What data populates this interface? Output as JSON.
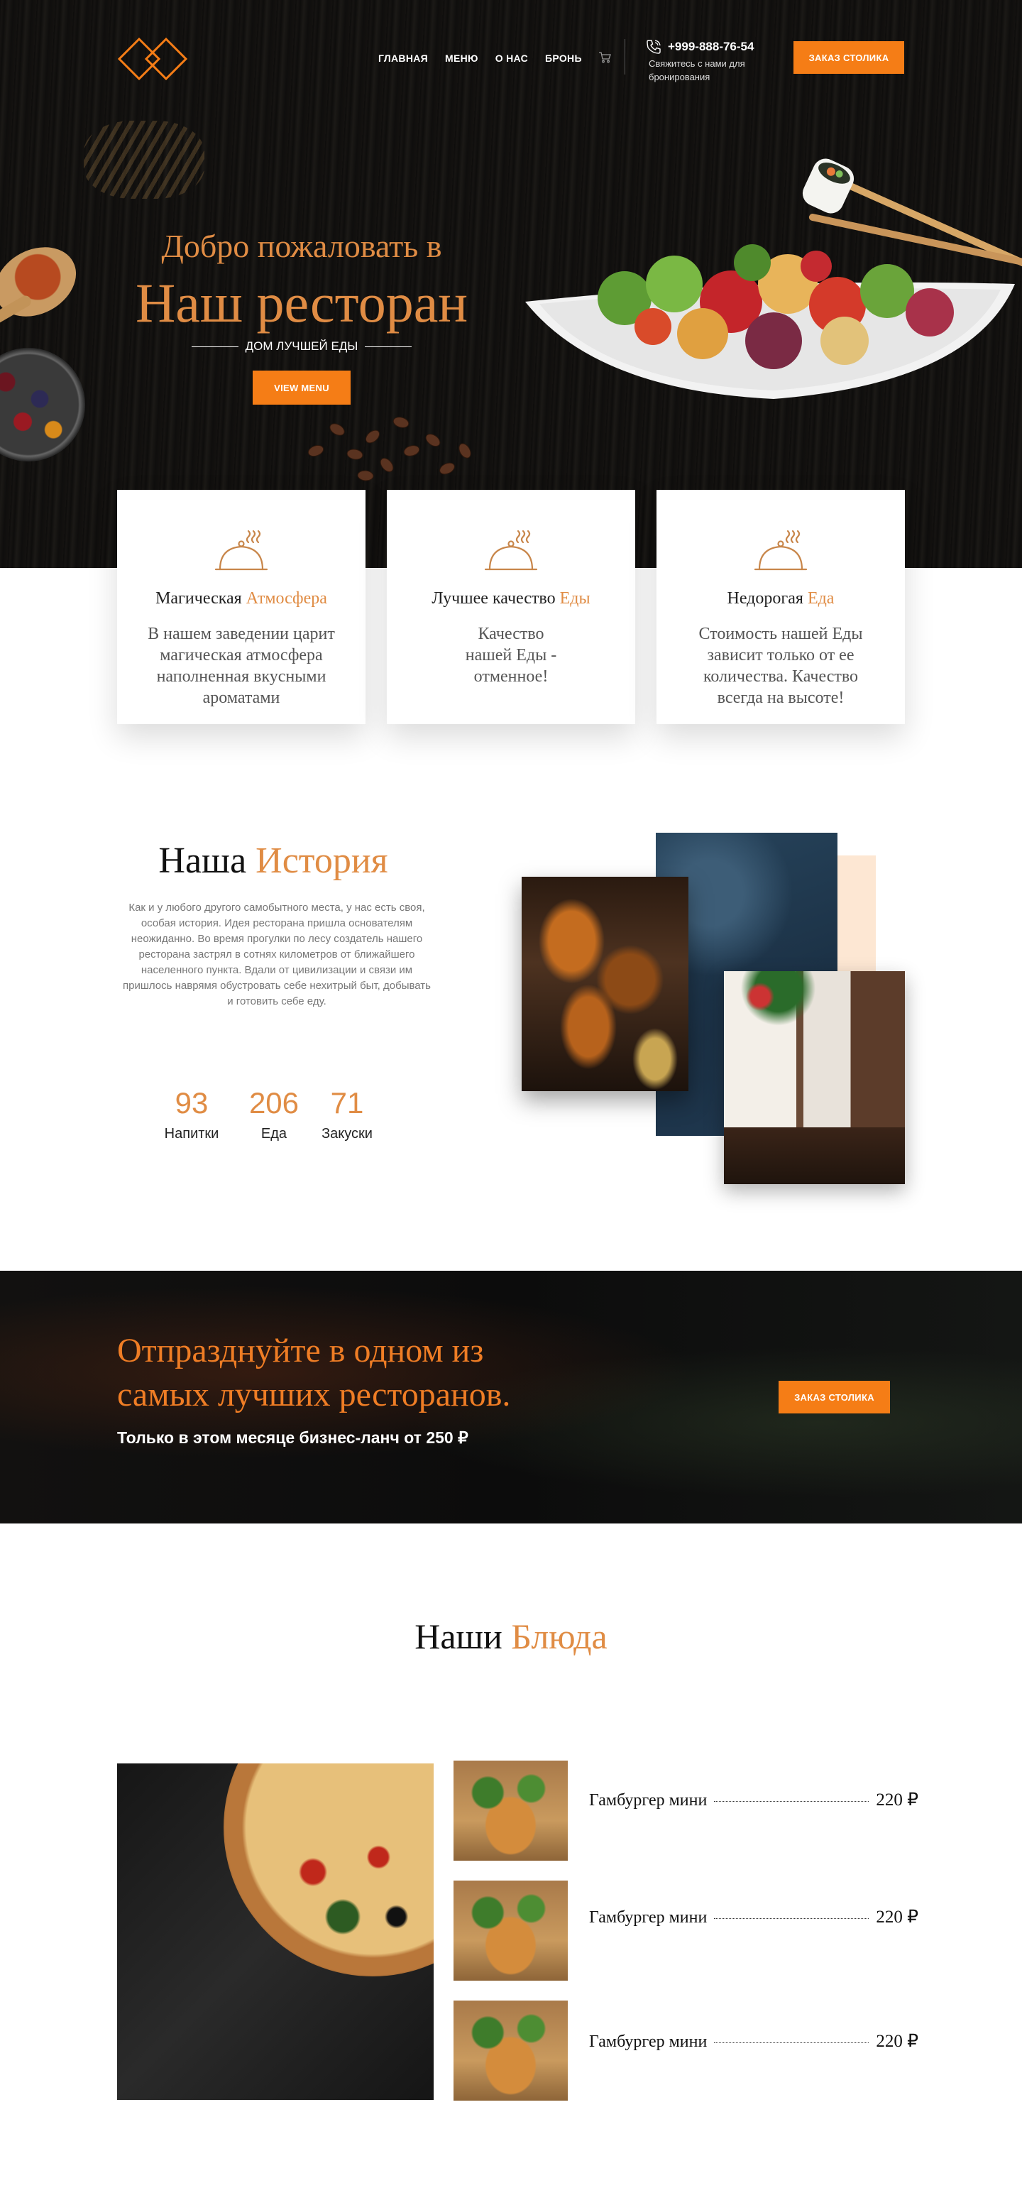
{
  "nav": {
    "items": [
      "ГЛАВНАЯ",
      "МЕНЮ",
      "О НАС",
      "БРОНЬ"
    ],
    "phone": "+999-888-76-54",
    "phone_sub": "Свяжитесь с нами для бронирования",
    "reserve_button": "ЗАКАЗ СТОЛИКА"
  },
  "hero": {
    "welcome": "Добро пожаловать в",
    "title": "Наш ресторан",
    "subtitle": "ДОМ ЛУЧШЕЙ ЕДЫ",
    "button": "VIEW MENU"
  },
  "features": [
    {
      "title": "Магическая",
      "accent": "Атмосфера",
      "text": "В нашем заведении царит магическая атмосфера наполненная вкусными ароматами"
    },
    {
      "title": "Лучшее качество",
      "accent": "Еды",
      "text": "Качество нашей Еды - отменное!"
    },
    {
      "title": "Недорогая",
      "accent": "Еда",
      "text": "Стоимость нашей Еды зависит только от ее количества. Качество всегда на высоте!"
    }
  ],
  "history": {
    "title": "Наша",
    "accent": "История",
    "text": "Как и у любого другого самобытного места, у нас есть своя, особая история. Идея ресторана пришла основателям неожиданно. Во время прогулки по лесу создатель нашего ресторана застрял в сотнях километров от ближайшего населенного пункта. Вдали от цивилизации и связи им пришлось наврямя обустровать себе нехитрый быт, добывать и готовить себе еду.",
    "stats": [
      {
        "value": "93",
        "label": "Напитки"
      },
      {
        "value": "206",
        "label": "Еда"
      },
      {
        "value": "71",
        "label": "Закуски"
      }
    ]
  },
  "promo": {
    "title": "Отпразднуйте в одном из самых лучших ресторанов.",
    "subtitle": "Только в этом месяце бизнес-ланч от 250 ₽",
    "button": "ЗАКАЗ СТОЛИКА"
  },
  "dishes": {
    "title": "Наши",
    "accent": "Блюда",
    "items": [
      {
        "name": "Гамбургер мини",
        "price": "220 ₽"
      },
      {
        "name": "Гамбургер мини",
        "price": "220 ₽"
      },
      {
        "name": "Гамбургер мини",
        "price": "220 ₽"
      }
    ]
  },
  "colors": {
    "accent": "#f57d16",
    "accent_text": "#e08c44",
    "dark": "#0f0e0d"
  },
  "icons": [
    "logo-diamonds-icon",
    "cart-icon",
    "phone-icon",
    "cloche-icon"
  ]
}
